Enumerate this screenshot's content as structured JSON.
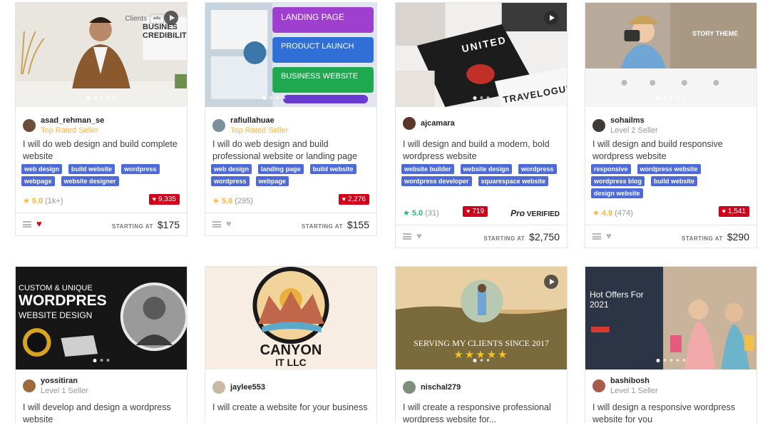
{
  "gigs": [
    {
      "seller": "asad_rehman_se",
      "level": "Top Rated Seller",
      "clients_label": "Clients",
      "client_logo_text": "sella",
      "title": "I will do web design and build complete website",
      "tags": [
        "web design",
        "build website",
        "wordpress",
        "webpage",
        "website designer"
      ],
      "rating": "5.0",
      "reviews": "(1k+)",
      "likes": "9,335",
      "starting_label": "STARTING AT",
      "price": "$175",
      "thumb_text": "BUSINES CREDIBILIT"
    },
    {
      "seller": "rafiullahuae",
      "level": "Top Rated Seller",
      "title": "I will do web design and build professional website or landing page",
      "tags": [
        "web design",
        "landing page",
        "build website",
        "wordpress",
        "webpage"
      ],
      "rating": "5.0",
      "reviews": "(295)",
      "likes": "2,276",
      "starting_label": "STARTING AT",
      "price": "$155",
      "thumb_labels": [
        "LANDING PAGE",
        "PRODUCT LAUNCH",
        "BUSINESS WEBSITE"
      ]
    },
    {
      "seller": "ajcamara",
      "level": "",
      "title": "I will design and build a modern, bold wordpress website",
      "tags": [
        "website builder",
        "website design",
        "wordpress",
        "wordpress developer",
        "squarespace website"
      ],
      "rating": "5.0",
      "reviews": "(31)",
      "likes": "719",
      "pro_label": "Pro",
      "verified_label": "VERIFIED",
      "starting_label": "STARTING AT",
      "price": "$2,750",
      "thumb_text": "UNITED",
      "thumb_text2": "TRAVELOGUE"
    },
    {
      "seller": "sohailms",
      "level": "Level 2 Seller",
      "title": "I will design and build responsive wordpress website",
      "tags": [
        "responsive",
        "wordpress website",
        "wordpress blog",
        "build website",
        "design website"
      ],
      "rating": "4.9",
      "reviews": "(474)",
      "likes": "1,541",
      "starting_label": "STARTING AT",
      "price": "$290",
      "thumb_text": "STORY THEME"
    },
    {
      "seller": "yossitiran",
      "level": "Level 1 Seller",
      "title": "I will develop and design a wordpress website",
      "thumb_lines": [
        "CUSTOM & UNIQUE",
        "WORDPRES",
        "WEBSITE DESIGN"
      ]
    },
    {
      "seller": "jaylee553",
      "level": "",
      "title": "I will create a website for your business",
      "thumb_lines": [
        "CANYON",
        "IT LLC"
      ]
    },
    {
      "seller": "nischal279",
      "level": "",
      "title": "I will create a responsive professional wordpress website for...",
      "thumb_text": "SERVING  MY  CLIENTS SINCE 2017"
    },
    {
      "seller": "bashibosh",
      "level": "Level 1 Seller",
      "title": "I will design a responsive wordpress website for you",
      "thumb_text": "Hot Offers For 2021"
    }
  ]
}
